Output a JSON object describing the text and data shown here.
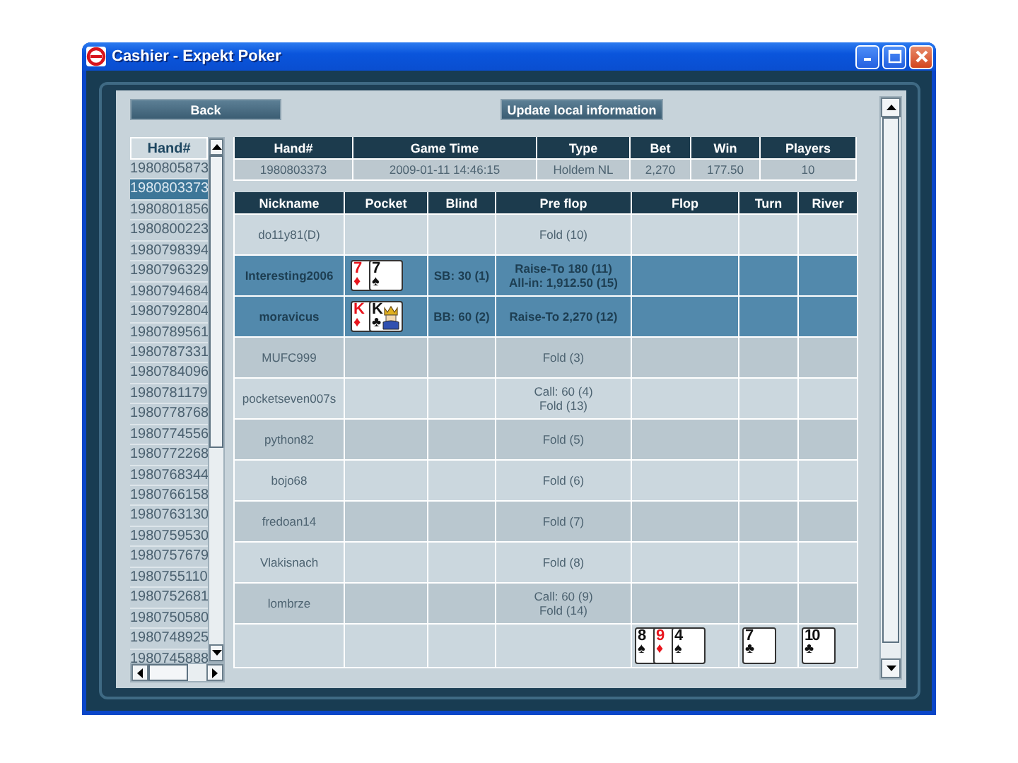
{
  "window": {
    "title": "Cashier - Expekt Poker"
  },
  "toolbar": {
    "back_button": "Back",
    "update_button": "Update local information"
  },
  "hand_list": {
    "header": "Hand#",
    "items": [
      {
        "label": "1980805873",
        "selected": false
      },
      {
        "label": "1980803373",
        "selected": true
      },
      {
        "label": "1980801856",
        "selected": false
      },
      {
        "label": "1980800223",
        "selected": false
      },
      {
        "label": "1980798394",
        "selected": false
      },
      {
        "label": "1980796329",
        "selected": false
      },
      {
        "label": "1980794684",
        "selected": false
      },
      {
        "label": "1980792804",
        "selected": false
      },
      {
        "label": "1980789561",
        "selected": false
      },
      {
        "label": "1980787331",
        "selected": false
      },
      {
        "label": "1980784096",
        "selected": false
      },
      {
        "label": "1980781179",
        "selected": false
      },
      {
        "label": "1980778768",
        "selected": false
      },
      {
        "label": "1980774556",
        "selected": false
      },
      {
        "label": "1980772268",
        "selected": false
      },
      {
        "label": "1980768344",
        "selected": false
      },
      {
        "label": "1980766158",
        "selected": false
      },
      {
        "label": "1980763130",
        "selected": false
      },
      {
        "label": "1980759530",
        "selected": false
      },
      {
        "label": "1980757679",
        "selected": false
      },
      {
        "label": "1980755110",
        "selected": false
      },
      {
        "label": "1980752681",
        "selected": false
      },
      {
        "label": "1980750580",
        "selected": false
      },
      {
        "label": "1980748925",
        "selected": false
      },
      {
        "label": "1980745888",
        "selected": false
      }
    ]
  },
  "summary": {
    "columns": [
      "Hand#",
      "Game Time",
      "Type",
      "Bet",
      "Win",
      "Players"
    ],
    "row": [
      "1980803373",
      "2009-01-11 14:46:15",
      "Holdem NL",
      "2,270",
      "177.50",
      "10"
    ]
  },
  "actions": {
    "columns": [
      "Nickname",
      "Pocket",
      "Blind",
      "Pre flop",
      "Flop",
      "Turn",
      "River"
    ],
    "rows": [
      {
        "nickname": "do11y81(D)",
        "highlighted": false,
        "pocket": [],
        "blind": "",
        "pre_flop": [
          "Fold (10)"
        ]
      },
      {
        "nickname": "Interesting2006",
        "highlighted": true,
        "pocket": [
          {
            "rank": "7",
            "suit": "♦",
            "color": "#e8141c"
          },
          {
            "rank": "7",
            "suit": "♠",
            "color": "#111111"
          }
        ],
        "blind": "SB: 30 (1)",
        "pre_flop": [
          "Raise-To 180 (11)",
          "All-in: 1,912.50 (15)"
        ]
      },
      {
        "nickname": "moravicus",
        "highlighted": true,
        "pocket": [
          {
            "rank": "K",
            "suit": "♦",
            "color": "#e8141c"
          },
          {
            "rank": "K",
            "suit": "♣",
            "color": "#111111",
            "face": true
          }
        ],
        "blind": "BB: 60 (2)",
        "pre_flop": [
          "Raise-To 2,270 (12)"
        ]
      },
      {
        "nickname": "MUFC999",
        "highlighted": false,
        "pocket": [],
        "blind": "",
        "pre_flop": [
          "Fold (3)"
        ]
      },
      {
        "nickname": "pocketseven007s",
        "highlighted": false,
        "pocket": [],
        "blind": "",
        "pre_flop": [
          "Call: 60 (4)",
          "Fold (13)"
        ]
      },
      {
        "nickname": "python82",
        "highlighted": false,
        "pocket": [],
        "blind": "",
        "pre_flop": [
          "Fold (5)"
        ]
      },
      {
        "nickname": "bojo68",
        "highlighted": false,
        "pocket": [],
        "blind": "",
        "pre_flop": [
          "Fold (6)"
        ]
      },
      {
        "nickname": "fredoan14",
        "highlighted": false,
        "pocket": [],
        "blind": "",
        "pre_flop": [
          "Fold (7)"
        ]
      },
      {
        "nickname": "Vlakisnach",
        "highlighted": false,
        "pocket": [],
        "blind": "",
        "pre_flop": [
          "Fold (8)"
        ]
      },
      {
        "nickname": "lombrze",
        "highlighted": false,
        "pocket": [],
        "blind": "",
        "pre_flop": [
          "Call: 60 (9)",
          "Fold (14)"
        ]
      }
    ],
    "board": {
      "flop": [
        {
          "rank": "8",
          "suit": "♠",
          "color": "#111111"
        },
        {
          "rank": "9",
          "suit": "♦",
          "color": "#e8141c"
        },
        {
          "rank": "4",
          "suit": "♠",
          "color": "#111111"
        }
      ],
      "turn": [
        {
          "rank": "7",
          "suit": "♣",
          "color": "#111111"
        }
      ],
      "river": [
        {
          "rank": "10",
          "suit": "♣",
          "color": "#111111"
        }
      ]
    }
  }
}
